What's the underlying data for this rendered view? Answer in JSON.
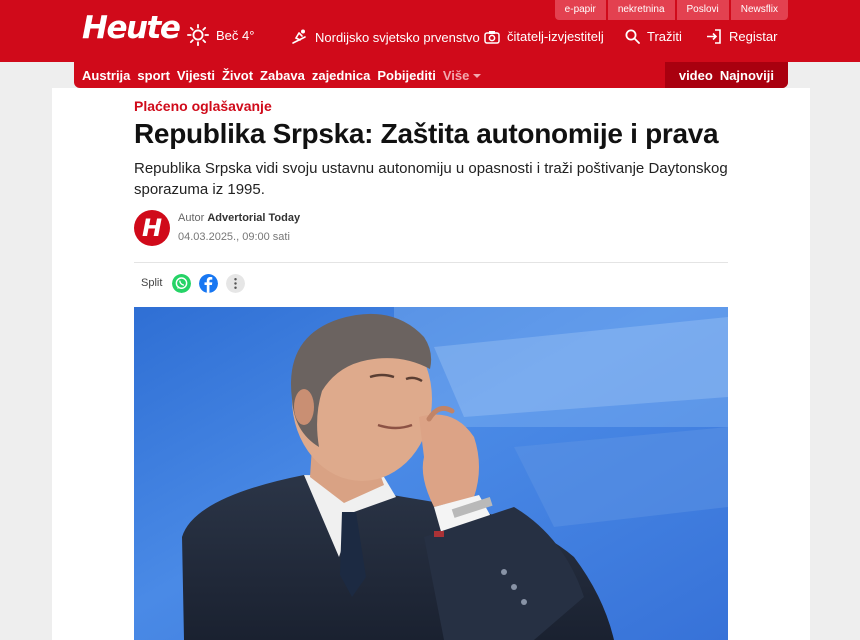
{
  "header": {
    "logo": "Heute",
    "weather": "Beč 4°",
    "nav": [
      {
        "label": "Nordijsko svjetsko prvenstvo",
        "icon": "skier-icon"
      },
      {
        "label": "čitatelj-izvjestitelj",
        "icon": "camera-icon"
      },
      {
        "label": "Tražiti",
        "icon": "search-icon"
      },
      {
        "label": "Registar",
        "icon": "login-icon"
      }
    ],
    "toplinks": [
      "e-papir",
      "nekretnina",
      "Poslovi",
      "Newsflix"
    ]
  },
  "categories": [
    "Austrija",
    "sport",
    "Vijesti",
    "Život",
    "Zabava",
    "zajednica",
    "Pobijediti",
    "Više"
  ],
  "categories_right": [
    "video",
    "Najnoviji"
  ],
  "article": {
    "kicker": "Plaćeno oglašavanje",
    "title": "Republika Srpska: Zaštita autonomije i prava",
    "lead": "Republika Srpska vidi svoju ustavnu autonomiju u opasnosti i traži poštivanje Daytonskog sporazuma iz 1995.",
    "author_label": "Autor",
    "author_name": "Advertorial Today",
    "date": "04.03.2025., 09:00 sati",
    "avatar_letter": "H",
    "share_label": "Split"
  },
  "colors": {
    "brand": "#d00a1a",
    "whatsapp": "#25d366",
    "facebook": "#1877f2"
  }
}
